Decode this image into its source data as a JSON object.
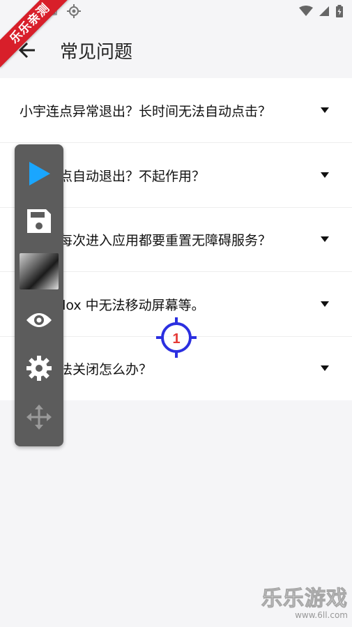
{
  "app_bar": {
    "title": "常见问题"
  },
  "ribbon": {
    "label": "乐乐亲测"
  },
  "faq": [
    {
      "question": "小宇连点异常退出？长时间无法自动点击？"
    },
    {
      "question": "小宇连点自动退出？不起作用？"
    },
    {
      "question": "为什么每次进入应用都要重置无障碍服务？"
    },
    {
      "question": "在 Roblox 中无法移动屏幕等。"
    },
    {
      "question": "小宇无法关闭怎么办？"
    }
  ],
  "target": {
    "number": "1"
  },
  "watermark": {
    "brand": "乐乐游戏",
    "url": "www.6ll.com"
  },
  "colors": {
    "accent": "#1aa6ff",
    "target_ring": "#2b2fe0",
    "target_number": "#e53935",
    "panel": "#5c5c5c",
    "ribbon": "#d81f2a"
  },
  "icons": {
    "back": "arrow-left-icon",
    "play": "play-icon",
    "save": "save-icon",
    "eye": "eye-icon",
    "settings": "gear-icon",
    "move": "move-icon",
    "expand": "triangle-down-icon"
  }
}
